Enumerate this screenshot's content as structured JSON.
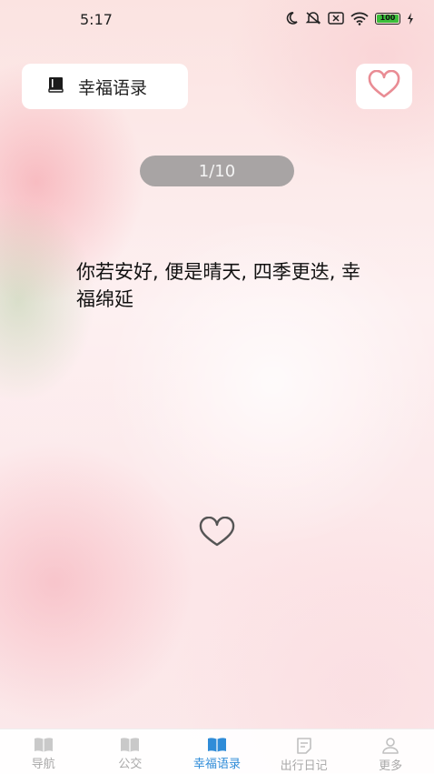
{
  "status_bar": {
    "time": "5:17",
    "battery": "100",
    "icons": [
      "moon-icon",
      "mute-icon",
      "sim-icon",
      "wifi-icon",
      "battery-icon",
      "charging-icon"
    ]
  },
  "header": {
    "title": "幸福语录",
    "title_icon": "book-icon",
    "favorite_icon": "heart-outline-icon"
  },
  "pager": {
    "text": "1/10"
  },
  "quote": {
    "text": "你若安好, 便是晴天, 四季更迭, 幸福绵延"
  },
  "like_icon": "heart-outline-icon",
  "colors": {
    "accent": "#2f8cd8",
    "inactive": "#a9a9a9",
    "heart": "#e98c94",
    "pager_bg": "#a8a4a4"
  },
  "bottom_nav": {
    "items": [
      {
        "label": "导航",
        "icon": "book-icon",
        "active": false
      },
      {
        "label": "公交",
        "icon": "book-icon",
        "active": false
      },
      {
        "label": "幸福语录",
        "icon": "book-icon",
        "active": true
      },
      {
        "label": "出行日记",
        "icon": "notes-icon",
        "active": false
      },
      {
        "label": "更多",
        "icon": "person-icon",
        "active": false
      }
    ]
  }
}
